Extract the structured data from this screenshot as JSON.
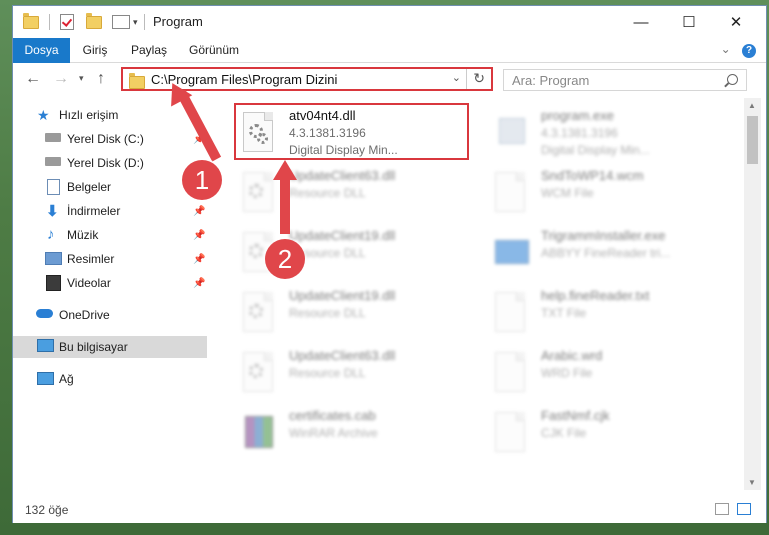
{
  "window": {
    "title": "Program"
  },
  "window_controls": {
    "minimize": "—",
    "maximize": "☐",
    "close": "✕"
  },
  "ribbon": {
    "tabs": [
      "Dosya",
      "Giriş",
      "Paylaş",
      "Görünüm"
    ],
    "expand_glyph": "⌄"
  },
  "nav": {
    "address": "C:\\Program Files\\Program Dizini",
    "search_placeholder": "Ara: Program"
  },
  "sidebar": {
    "items": [
      {
        "label": "Hızlı erişim",
        "icon": "star-icon",
        "pinned": false
      },
      {
        "label": "Yerel Disk (C:)",
        "icon": "drive-icon",
        "pinned": true
      },
      {
        "label": "Yerel Disk (D:)",
        "icon": "drive-icon",
        "pinned": false
      },
      {
        "label": "Belgeler",
        "icon": "documents-icon",
        "pinned": true
      },
      {
        "label": "İndirmeler",
        "icon": "download-icon",
        "pinned": true
      },
      {
        "label": "Müzik",
        "icon": "music-icon",
        "pinned": true
      },
      {
        "label": "Resimler",
        "icon": "pictures-icon",
        "pinned": true
      },
      {
        "label": "Videolar",
        "icon": "video-icon",
        "pinned": true
      },
      {
        "label": "OneDrive",
        "icon": "cloud-icon",
        "pinned": false
      },
      {
        "label": "Bu bilgisayar",
        "icon": "computer-icon",
        "pinned": false,
        "selected": true
      },
      {
        "label": "Ağ",
        "icon": "network-icon",
        "pinned": false
      }
    ]
  },
  "files": [
    {
      "name": "atv04nt4.dll",
      "sub1": "4.3.1381.3196",
      "sub2": "Digital Display Min...",
      "type": "dll",
      "highlight": true
    },
    {
      "name": "program.exe",
      "sub1": "4.3.1381.3196",
      "sub2": "Digital Display Min...",
      "type": "exe"
    },
    {
      "name": "UpdateClient63.dll",
      "sub1": "Resource DLL",
      "sub2": "",
      "type": "dll"
    },
    {
      "name": "SndToWP14.wcm",
      "sub1": "WCM File",
      "sub2": "",
      "type": "doc"
    },
    {
      "name": "UpdateClient19.dll",
      "sub1": "Resource DLL",
      "sub2": "",
      "type": "dll"
    },
    {
      "name": "TrigrammInstaller.exe",
      "sub1": "ABBYY FineReader tri...",
      "sub2": "",
      "type": "exe"
    },
    {
      "name": "UpdateClient19.dll",
      "sub1": "Resource DLL",
      "sub2": "",
      "type": "dll"
    },
    {
      "name": "help.fineReader.txt",
      "sub1": "TXT File",
      "sub2": "",
      "type": "doc"
    },
    {
      "name": "UpdateClient63.dll",
      "sub1": "Resource DLL",
      "sub2": "",
      "type": "dll"
    },
    {
      "name": "Arabic.wrd",
      "sub1": "WRD File",
      "sub2": "",
      "type": "doc"
    },
    {
      "name": "certificates.cab",
      "sub1": "WinRAR Archive",
      "sub2": "",
      "type": "rar"
    },
    {
      "name": "FastNmf.cjk",
      "sub1": "CJK File",
      "sub2": "",
      "type": "doc"
    }
  ],
  "status": {
    "item_count": "132 öğe"
  },
  "callouts": [
    "1",
    "2"
  ],
  "colors": {
    "accent": "#1979ca",
    "callout": "#e0464a",
    "highlight_border": "#d9373d"
  }
}
